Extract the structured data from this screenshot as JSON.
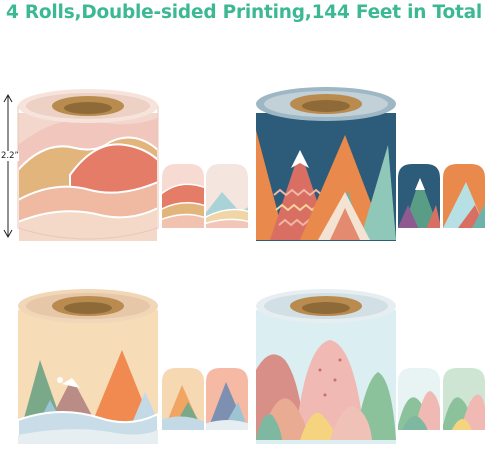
{
  "headline": "4 Rolls,Double-sided Printing,144 Feet in Total",
  "dimension_label": "2.2”",
  "colors": {
    "headline": "#3cb893",
    "roll_core": "#b98b4e",
    "roll1": [
      "#f1c7bd",
      "#e57c67",
      "#e2b57d",
      "#f4d9c8"
    ],
    "roll2": [
      "#2d5b7a",
      "#e98a4c",
      "#d96f63",
      "#6fb2a9"
    ],
    "roll3": [
      "#f7dcb8",
      "#f08a50",
      "#7aa98a",
      "#c4d9e6"
    ],
    "roll4": [
      "#dbeef2",
      "#d88f88",
      "#8cc29b",
      "#f0b9b3"
    ]
  }
}
